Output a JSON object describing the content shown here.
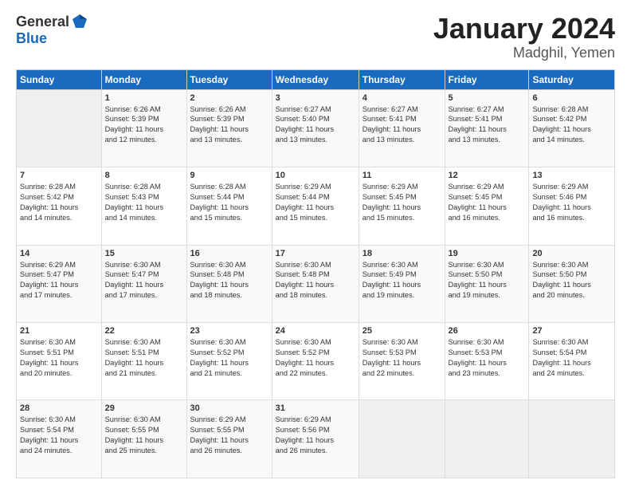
{
  "logo": {
    "general": "General",
    "blue": "Blue"
  },
  "header": {
    "month": "January 2024",
    "location": "Madghil, Yemen"
  },
  "columns": [
    "Sunday",
    "Monday",
    "Tuesday",
    "Wednesday",
    "Thursday",
    "Friday",
    "Saturday"
  ],
  "weeks": [
    [
      {
        "day": "",
        "content": ""
      },
      {
        "day": "1",
        "content": "Sunrise: 6:26 AM\nSunset: 5:39 PM\nDaylight: 11 hours\nand 12 minutes."
      },
      {
        "day": "2",
        "content": "Sunrise: 6:26 AM\nSunset: 5:39 PM\nDaylight: 11 hours\nand 13 minutes."
      },
      {
        "day": "3",
        "content": "Sunrise: 6:27 AM\nSunset: 5:40 PM\nDaylight: 11 hours\nand 13 minutes."
      },
      {
        "day": "4",
        "content": "Sunrise: 6:27 AM\nSunset: 5:41 PM\nDaylight: 11 hours\nand 13 minutes."
      },
      {
        "day": "5",
        "content": "Sunrise: 6:27 AM\nSunset: 5:41 PM\nDaylight: 11 hours\nand 13 minutes."
      },
      {
        "day": "6",
        "content": "Sunrise: 6:28 AM\nSunset: 5:42 PM\nDaylight: 11 hours\nand 14 minutes."
      }
    ],
    [
      {
        "day": "7",
        "content": "Sunrise: 6:28 AM\nSunset: 5:42 PM\nDaylight: 11 hours\nand 14 minutes."
      },
      {
        "day": "8",
        "content": "Sunrise: 6:28 AM\nSunset: 5:43 PM\nDaylight: 11 hours\nand 14 minutes."
      },
      {
        "day": "9",
        "content": "Sunrise: 6:28 AM\nSunset: 5:44 PM\nDaylight: 11 hours\nand 15 minutes."
      },
      {
        "day": "10",
        "content": "Sunrise: 6:29 AM\nSunset: 5:44 PM\nDaylight: 11 hours\nand 15 minutes."
      },
      {
        "day": "11",
        "content": "Sunrise: 6:29 AM\nSunset: 5:45 PM\nDaylight: 11 hours\nand 15 minutes."
      },
      {
        "day": "12",
        "content": "Sunrise: 6:29 AM\nSunset: 5:45 PM\nDaylight: 11 hours\nand 16 minutes."
      },
      {
        "day": "13",
        "content": "Sunrise: 6:29 AM\nSunset: 5:46 PM\nDaylight: 11 hours\nand 16 minutes."
      }
    ],
    [
      {
        "day": "14",
        "content": "Sunrise: 6:29 AM\nSunset: 5:47 PM\nDaylight: 11 hours\nand 17 minutes."
      },
      {
        "day": "15",
        "content": "Sunrise: 6:30 AM\nSunset: 5:47 PM\nDaylight: 11 hours\nand 17 minutes."
      },
      {
        "day": "16",
        "content": "Sunrise: 6:30 AM\nSunset: 5:48 PM\nDaylight: 11 hours\nand 18 minutes."
      },
      {
        "day": "17",
        "content": "Sunrise: 6:30 AM\nSunset: 5:48 PM\nDaylight: 11 hours\nand 18 minutes."
      },
      {
        "day": "18",
        "content": "Sunrise: 6:30 AM\nSunset: 5:49 PM\nDaylight: 11 hours\nand 19 minutes."
      },
      {
        "day": "19",
        "content": "Sunrise: 6:30 AM\nSunset: 5:50 PM\nDaylight: 11 hours\nand 19 minutes."
      },
      {
        "day": "20",
        "content": "Sunrise: 6:30 AM\nSunset: 5:50 PM\nDaylight: 11 hours\nand 20 minutes."
      }
    ],
    [
      {
        "day": "21",
        "content": "Sunrise: 6:30 AM\nSunset: 5:51 PM\nDaylight: 11 hours\nand 20 minutes."
      },
      {
        "day": "22",
        "content": "Sunrise: 6:30 AM\nSunset: 5:51 PM\nDaylight: 11 hours\nand 21 minutes."
      },
      {
        "day": "23",
        "content": "Sunrise: 6:30 AM\nSunset: 5:52 PM\nDaylight: 11 hours\nand 21 minutes."
      },
      {
        "day": "24",
        "content": "Sunrise: 6:30 AM\nSunset: 5:52 PM\nDaylight: 11 hours\nand 22 minutes."
      },
      {
        "day": "25",
        "content": "Sunrise: 6:30 AM\nSunset: 5:53 PM\nDaylight: 11 hours\nand 22 minutes."
      },
      {
        "day": "26",
        "content": "Sunrise: 6:30 AM\nSunset: 5:53 PM\nDaylight: 11 hours\nand 23 minutes."
      },
      {
        "day": "27",
        "content": "Sunrise: 6:30 AM\nSunset: 5:54 PM\nDaylight: 11 hours\nand 24 minutes."
      }
    ],
    [
      {
        "day": "28",
        "content": "Sunrise: 6:30 AM\nSunset: 5:54 PM\nDaylight: 11 hours\nand 24 minutes."
      },
      {
        "day": "29",
        "content": "Sunrise: 6:30 AM\nSunset: 5:55 PM\nDaylight: 11 hours\nand 25 minutes."
      },
      {
        "day": "30",
        "content": "Sunrise: 6:29 AM\nSunset: 5:55 PM\nDaylight: 11 hours\nand 26 minutes."
      },
      {
        "day": "31",
        "content": "Sunrise: 6:29 AM\nSunset: 5:56 PM\nDaylight: 11 hours\nand 26 minutes."
      },
      {
        "day": "",
        "content": ""
      },
      {
        "day": "",
        "content": ""
      },
      {
        "day": "",
        "content": ""
      }
    ]
  ]
}
